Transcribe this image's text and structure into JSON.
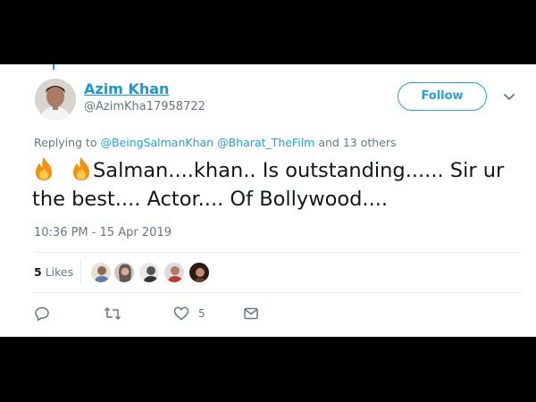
{
  "tweet": {
    "display_name": "Azim Khan",
    "handle": "@AzimKha17958722",
    "follow_label": "Follow",
    "replying_prefix": "Replying to",
    "reply_to_1": "@BeingSalmanKhan",
    "reply_to_2": "@Bharat_TheFilm",
    "reply_suffix": "and 13 others",
    "text": "Salman....khan.. Is outstanding...... Sir ur the best.... Actor.... Of Bollywood....",
    "emoji": [
      "fire-icon",
      "fire-icon"
    ],
    "timestamp": "10:36 PM - 15 Apr 2019",
    "likes_count": "5",
    "likes_label": "Likes",
    "like_action_count": "5"
  },
  "colors": {
    "accent": "#1da1f2",
    "name_link": "#1b95e0",
    "muted": "#657786",
    "text": "#14171a",
    "frame": "#000000"
  },
  "icons": [
    "reply-icon",
    "retweet-icon",
    "heart-icon",
    "message-icon",
    "chevron-down-icon"
  ]
}
